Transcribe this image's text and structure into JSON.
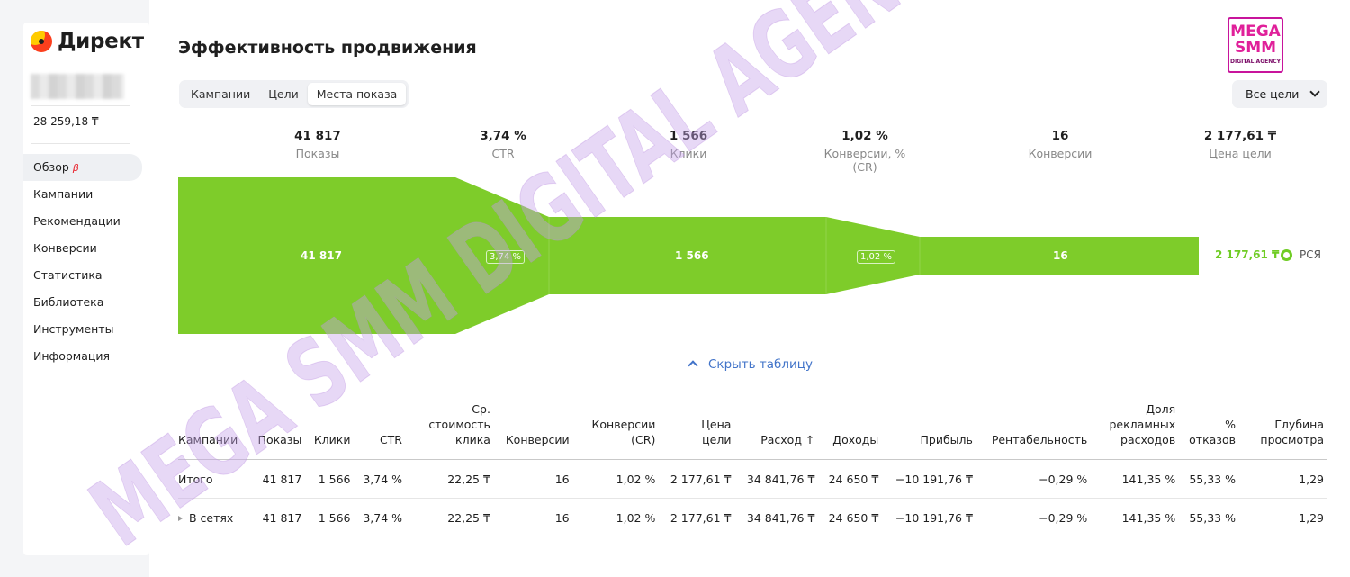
{
  "sidebar": {
    "logo_text": "Директ",
    "balance": "28 259,18 ₸",
    "beta_mark": "β",
    "items": [
      {
        "label": "Обзор",
        "active": true
      },
      {
        "label": "Кампании"
      },
      {
        "label": "Рекомендации"
      },
      {
        "label": "Конверсии"
      },
      {
        "label": "Статистика"
      },
      {
        "label": "Библиотека"
      },
      {
        "label": "Инструменты"
      },
      {
        "label": "Информация"
      }
    ]
  },
  "header": {
    "title": "Эффективность продвижения",
    "tabs": [
      "Кампании",
      "Цели",
      "Места показа"
    ],
    "active_tab": "Места показа",
    "goals_select": "Все цели"
  },
  "brand": {
    "line1": "MEGA",
    "line2": "SMM",
    "line3": "DIGITAL AGENCY"
  },
  "funnel": {
    "metrics": [
      {
        "value": "41 817",
        "label": "Показы"
      },
      {
        "value": "3,74 %",
        "label": "CTR"
      },
      {
        "value": "1 566",
        "label": "Клики"
      },
      {
        "value": "1,02 %",
        "label": "Конверсии, % (CR)"
      },
      {
        "value": "16",
        "label": "Конверсии"
      },
      {
        "value": "2 177,61 ₸",
        "label": "Цена цели"
      }
    ],
    "bar_labels": {
      "impressions": "41 817",
      "ctr": "3,74 %",
      "clicks": "1 566",
      "cr": "1,02 %",
      "conversions": "16"
    },
    "goal_price": "2 177,61 ₸",
    "legend": "РСЯ",
    "color": "#7ecc2a"
  },
  "hide_table": "Скрыть таблицу",
  "table": {
    "headers": [
      "Кампании",
      "Показы",
      "Клики",
      "CTR",
      "Ср. стоимость клика",
      "Конверсии",
      "Конверсии (CR)",
      "Цена цели",
      "Расход ↑",
      "Доходы",
      "Прибыль",
      "Рентабельность",
      "Доля рекламных расходов",
      "% отказов",
      "Глубина просмотра"
    ],
    "rows": [
      [
        "Итого",
        "41 817",
        "1 566",
        "3,74 %",
        "22,25 ₸",
        "16",
        "1,02 %",
        "2 177,61 ₸",
        "34 841,76 ₸",
        "24 650 ₸",
        "−10 191,76 ₸",
        "−0,29 %",
        "141,35 %",
        "55,33 %",
        "1,29"
      ],
      [
        "В сетях",
        "41 817",
        "1 566",
        "3,74 %",
        "22,25 ₸",
        "16",
        "1,02 %",
        "2 177,61 ₸",
        "34 841,76 ₸",
        "24 650 ₸",
        "−10 191,76 ₸",
        "−0,29 %",
        "141,35 %",
        "55,33 %",
        "1,29"
      ]
    ]
  },
  "watermark": {
    "text": "MEGA SMM DIGITAL AGENCY"
  }
}
